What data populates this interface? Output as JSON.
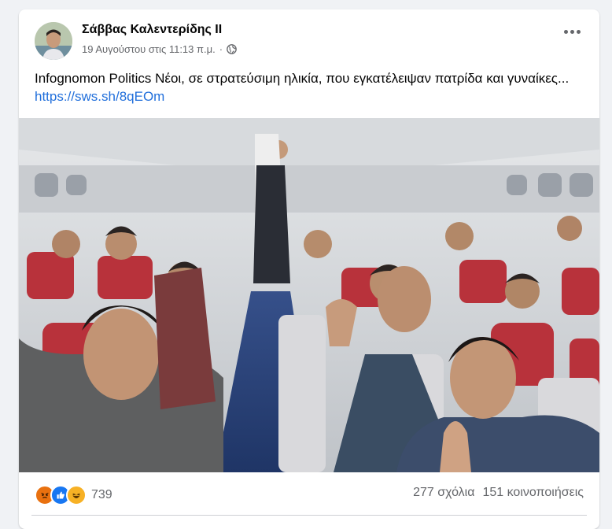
{
  "post": {
    "author": "Σάββας Καλεντερίδης ΙΙ",
    "date": "19 Αυγούστου στις 11:13 π.μ.",
    "separator": "·",
    "privacy_icon": "globe-icon",
    "text": "Infognomon Politics Νέοι, σε στρατεύσιμη ηλικία, που εγκατέλειψαν πατρίδα και γυναίκες...",
    "link": "https://sws.sh/8qEOm",
    "more_icon": "ellipsis-icon"
  },
  "footer": {
    "reaction_icons": [
      "angry-icon",
      "like-icon",
      "haha-icon"
    ],
    "reaction_count": "739",
    "comments": "277 σχόλια",
    "shares": "151 κοινοποιήσεις"
  },
  "colors": {
    "link": "#216fdb",
    "angry": "#e9710f",
    "like": "#1877f2",
    "haha": "#f7b125"
  }
}
